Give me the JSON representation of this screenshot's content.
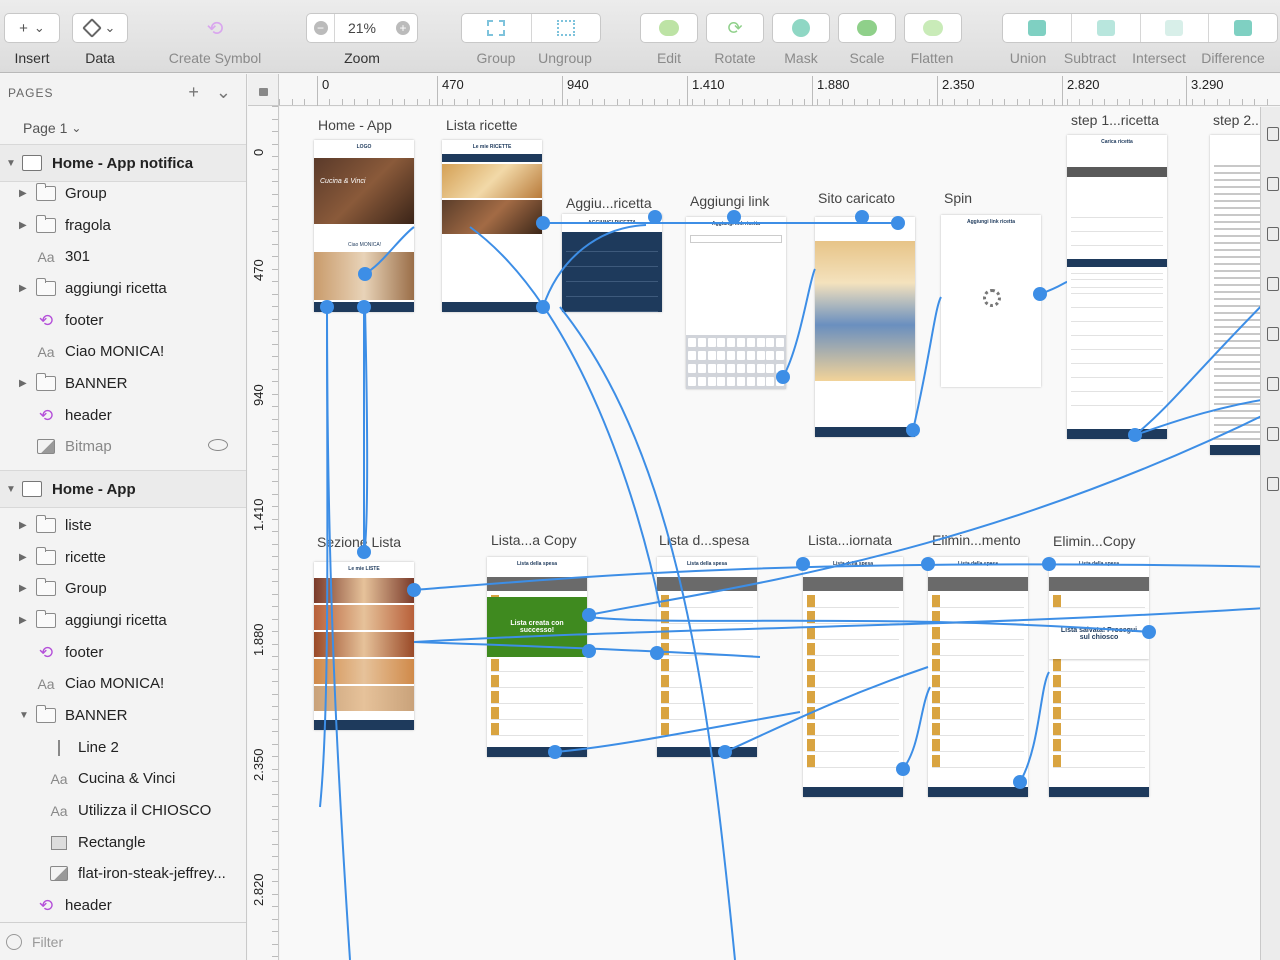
{
  "toolbar": {
    "insert": "Insert",
    "data": "Data",
    "create_symbol": "Create Symbol",
    "zoom": "Zoom",
    "zoom_value": "21%",
    "zoom_minus": "−",
    "zoom_plus": "+",
    "group": "Group",
    "ungroup": "Ungroup",
    "edit": "Edit",
    "rotate": "Rotate",
    "mask": "Mask",
    "scale": "Scale",
    "flatten": "Flatten",
    "union": "Union",
    "subtract": "Subtract",
    "intersect": "Intersect",
    "difference": "Difference",
    "plus": "+",
    "chevron": "⌄"
  },
  "sidebar": {
    "pages_title": "PAGES",
    "current_page": "Page 1",
    "add": "+",
    "collapse": "⌄",
    "filter_placeholder": "Filter",
    "layers": [
      {
        "name": "Home - App notifica",
        "type": "artboard"
      },
      {
        "name": "Group",
        "type": "folder"
      },
      {
        "name": "fragola",
        "type": "folder"
      },
      {
        "name": "301",
        "type": "text"
      },
      {
        "name": "aggiungi ricetta",
        "type": "folder"
      },
      {
        "name": "footer",
        "type": "symbol"
      },
      {
        "name": "Ciao MONICA!",
        "type": "text"
      },
      {
        "name": "BANNER",
        "type": "folder"
      },
      {
        "name": "header",
        "type": "symbol"
      },
      {
        "name": "Bitmap",
        "type": "bitmap"
      },
      {
        "name": "Home - App",
        "type": "artboard"
      },
      {
        "name": "liste",
        "type": "folder"
      },
      {
        "name": "ricette",
        "type": "folder"
      },
      {
        "name": "Group",
        "type": "folder"
      },
      {
        "name": "aggiungi ricetta",
        "type": "folder"
      },
      {
        "name": "footer",
        "type": "symbol"
      },
      {
        "name": "Ciao MONICA!",
        "type": "text"
      },
      {
        "name": "BANNER",
        "type": "folder"
      },
      {
        "name": "Line 2",
        "type": "line"
      },
      {
        "name": "Cucina & Vinci",
        "type": "text"
      },
      {
        "name": "Utilizza il CHIOSCO",
        "type": "text"
      },
      {
        "name": "Rectangle",
        "type": "rect"
      },
      {
        "name": "flat-iron-steak-jeffrey...",
        "type": "bitmap"
      },
      {
        "name": "header",
        "type": "symbol"
      }
    ]
  },
  "rulers": {
    "top": [
      "0",
      "470",
      "940",
      "1.410",
      "1.880",
      "2.350",
      "2.820",
      "3.290"
    ],
    "left": [
      "0",
      "470",
      "940",
      "1.410",
      "1.880",
      "2.350",
      "2.820"
    ]
  },
  "artboards": [
    {
      "title": "Home - App",
      "header": "LOGO",
      "banner": "Cucina & Vinci",
      "greeting": "Ciao MONICA!"
    },
    {
      "title": "Lista ricette",
      "header": "Le mie RICETTE"
    },
    {
      "title": "Aggiu...ricetta",
      "header": "AGGIUNGI RICETTA"
    },
    {
      "title": "Aggiungi link",
      "header": "Aggiungi link ricetta"
    },
    {
      "title": "Sito caricato",
      "header": ""
    },
    {
      "title": "Spin",
      "header": "Aggiungi link ricetta"
    },
    {
      "title": "step 1...ricetta",
      "header": "Carica ricetta"
    },
    {
      "title": "step 2...",
      "header": ""
    },
    {
      "title": "Sezione Lista",
      "header": "Le mie LISTE"
    },
    {
      "title": "Lista...a Copy",
      "header": "Lista della spesa",
      "overlay": "Lista creata con successo!"
    },
    {
      "title": "Lista d...spesa",
      "header": "Lista della spesa"
    },
    {
      "title": "Lista...iornata",
      "header": "Lista della spesa"
    },
    {
      "title": "Elimin...mento",
      "header": "Lista della spesa"
    },
    {
      "title": "Elimin...Copy",
      "header": "Lista della spesa",
      "overlay": "Lista salvata! Prosegui sul chiosco"
    }
  ],
  "colors": {
    "flow": "#3d8ee6",
    "navy": "#1e3a5c",
    "success_green": "#3f8a1f",
    "symbol_purple": "#b44fd9"
  },
  "icons": {
    "insert": "plus-icon",
    "data": "layers-icon",
    "create_symbol": "symbol-icon",
    "hidden": "eye-hidden-icon",
    "lock": "lock-icon",
    "filter": "filter-icon"
  }
}
